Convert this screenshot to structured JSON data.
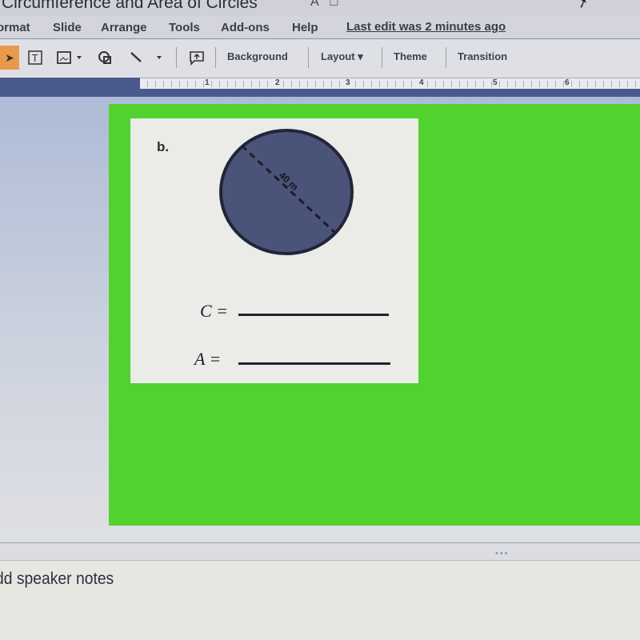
{
  "app": {
    "doc_title": "Circumference and Area of Circles",
    "last_edit": "Last edit was 2 minutes ago"
  },
  "menu": {
    "items": [
      "ormat",
      "Slide",
      "Arrange",
      "Tools",
      "Add-ons",
      "Help"
    ]
  },
  "toolbar": {
    "background_label": "Background",
    "layout_label": "Layout ▾",
    "theme_label": "Theme",
    "transition_label": "Transition",
    "icons": [
      "select-cursor-icon",
      "text-box-icon",
      "image-icon",
      "shape-icon",
      "line-icon",
      "comment-icon"
    ]
  },
  "ruler": {
    "numbers": [
      "1",
      "2",
      "3",
      "4",
      "5",
      "6"
    ]
  },
  "slide": {
    "background_color": "#52d22e",
    "problem_label": "b.",
    "circle": {
      "diameter_label": "40 m",
      "fill_color": "#4a5378"
    },
    "circumference_label": "C =",
    "area_label": "A ="
  },
  "notes": {
    "placeholder": "dd speaker notes",
    "resize_handle": "•••"
  }
}
